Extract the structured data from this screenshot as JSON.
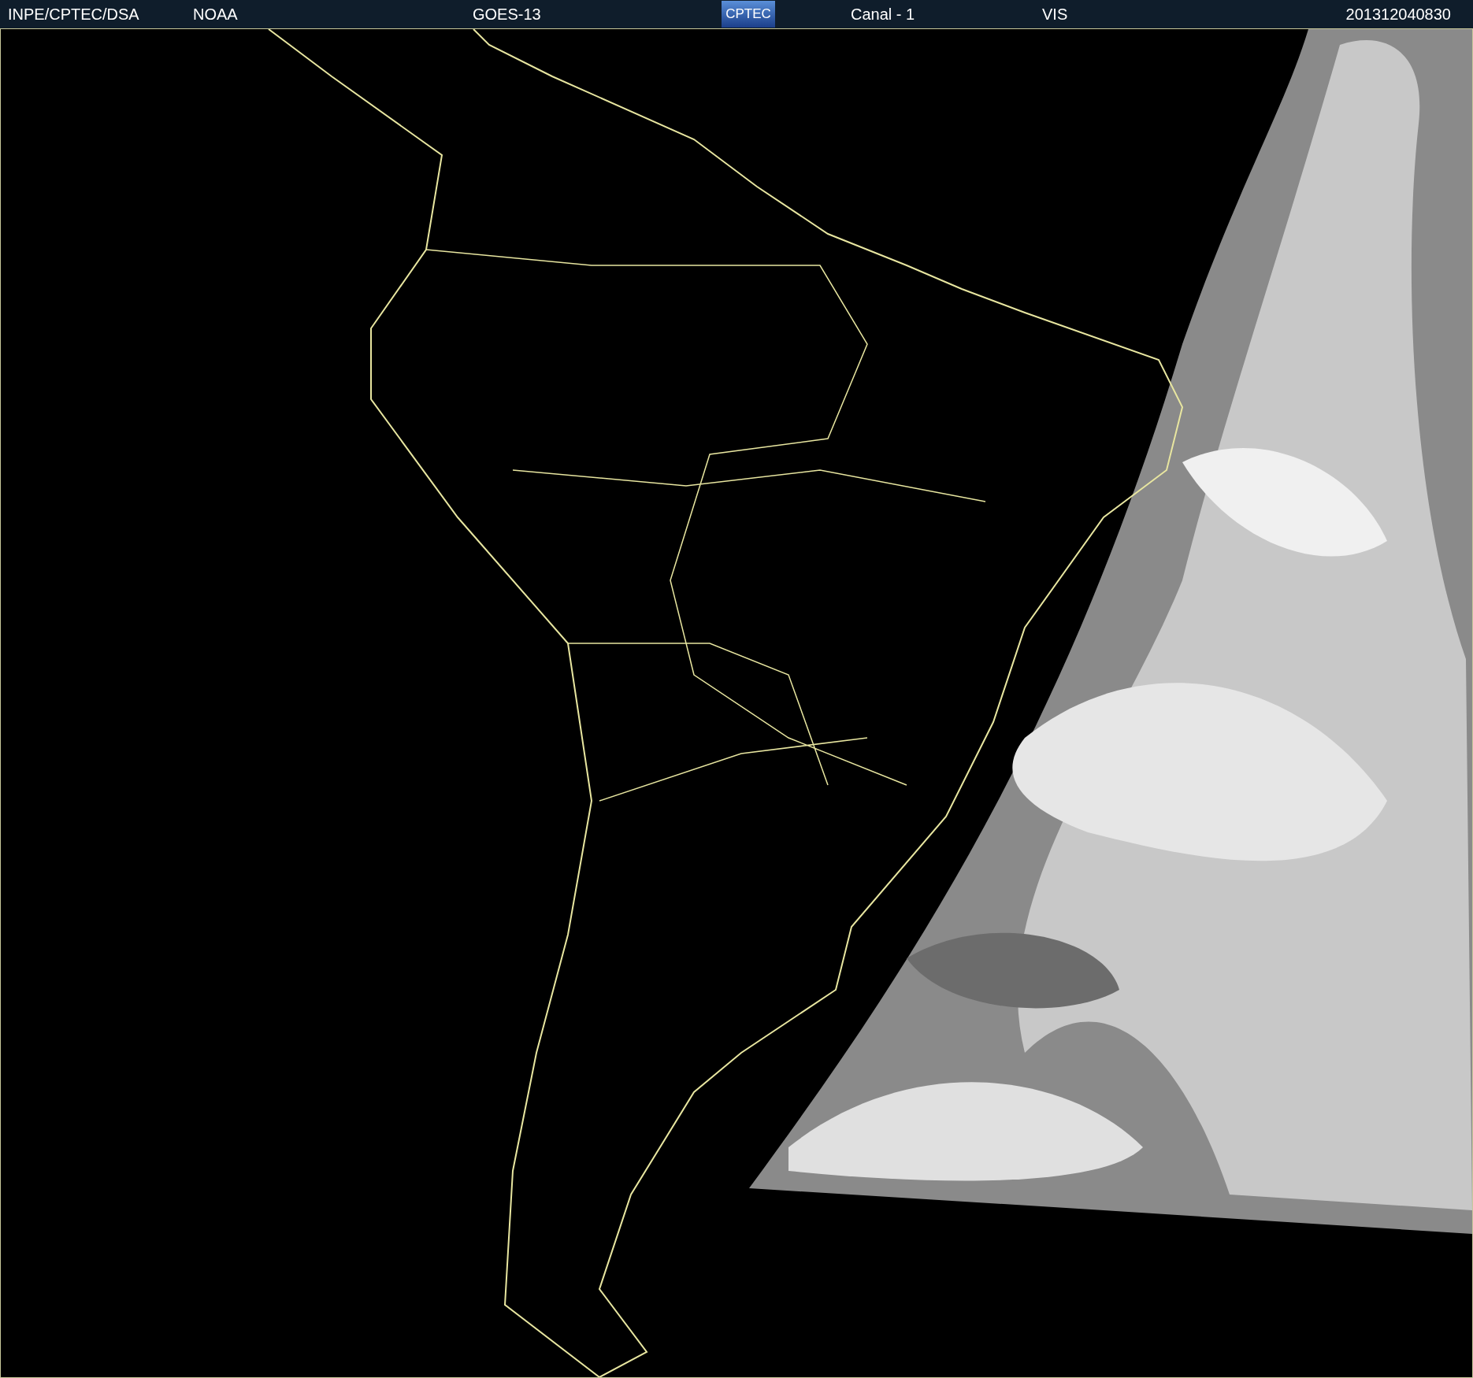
{
  "header": {
    "source": "INPE/CPTEC/DSA",
    "agency": "NOAA",
    "satellite": "GOES-13",
    "logo": "CPTEC",
    "channel": "Canal - 1",
    "band": "VIS",
    "timestamp": "201312040830"
  }
}
